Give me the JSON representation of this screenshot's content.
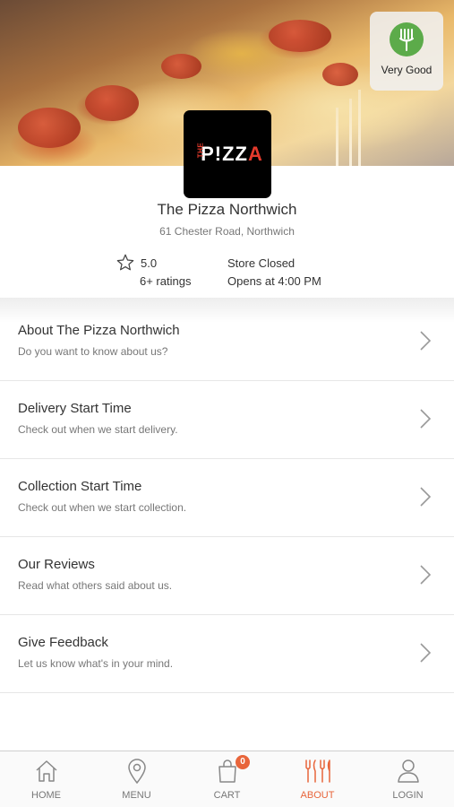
{
  "hero": {
    "rating_badge_label": "Very Good",
    "accent_color": "#5cab4a"
  },
  "logo": {
    "prefix": "THE",
    "text": "P!ZZ",
    "suffix": "A"
  },
  "store": {
    "name": "The Pizza Northwich",
    "address": "61 Chester Road, Northwich",
    "score": "5.0",
    "ratings": "6+ ratings",
    "status": "Store Closed",
    "opens": "Opens at 4:00 PM"
  },
  "menu": [
    {
      "title": "About The Pizza Northwich",
      "subtitle": "Do you want to know about us?"
    },
    {
      "title": "Delivery Start Time",
      "subtitle": "Check out when we start delivery."
    },
    {
      "title": "Collection Start Time",
      "subtitle": "Check out when we start collection."
    },
    {
      "title": "Our Reviews",
      "subtitle": "Read what others said about us."
    },
    {
      "title": "Give Feedback",
      "subtitle": "Let us know what's in your mind."
    }
  ],
  "tabs": {
    "home": "HOME",
    "menu": "MENU",
    "cart": "CART",
    "cart_count": "0",
    "about": "ABOUT",
    "login": "LOGIN",
    "active_color": "#e8653b"
  }
}
